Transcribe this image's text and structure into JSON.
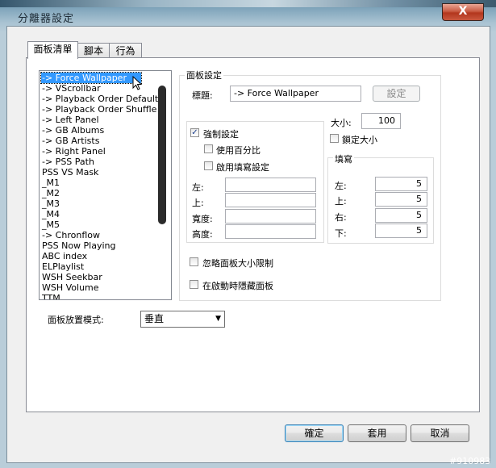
{
  "window": {
    "title": "分離器設定",
    "close_glyph": "X"
  },
  "tabs": [
    {
      "label": "面板清單",
      "active": true
    },
    {
      "label": "腳本",
      "active": false
    },
    {
      "label": "行為",
      "active": false
    }
  ],
  "panel_list": {
    "selected_index": 0,
    "items": [
      "-> Force Wallpaper",
      "-> VScrollbar",
      "-> Playback Order Default",
      "-> Playback Order Shuffle",
      "-> Left Panel",
      "-> GB Albums",
      "-> GB Artists",
      "-> Right Panel",
      "-> PSS Path",
      "PSS VS Mask",
      "_M1",
      "_M2",
      "_M3",
      "_M4",
      "_M5",
      "-> Chronflow",
      "PSS Now Playing",
      "ABC index",
      "ELPlaylist",
      "WSH Seekbar",
      "WSH Volume",
      "TTM"
    ]
  },
  "panel_settings": {
    "group_label": "面板設定",
    "title_label": "標題:",
    "title_value": "-> Force Wallpaper",
    "set_button": "設定",
    "force_settings": {
      "label": "強制設定",
      "checked": true
    },
    "use_percent": {
      "label": "使用百分比",
      "checked": false
    },
    "enable_fill": {
      "label": "啟用填寫設定",
      "checked": false
    },
    "pos_fields": [
      {
        "label": "左:",
        "value": ""
      },
      {
        "label": "上:",
        "value": ""
      },
      {
        "label": "寬度:",
        "value": ""
      },
      {
        "label": "高度:",
        "value": ""
      }
    ],
    "size_label": "大小:",
    "size_value": "100",
    "lock_size": {
      "label": "鎖定大小",
      "checked": false
    },
    "fill_group_label": "填寫",
    "fill_fields": [
      {
        "label": "左:",
        "value": "5"
      },
      {
        "label": "上:",
        "value": "5"
      },
      {
        "label": "右:",
        "value": "5"
      },
      {
        "label": "下:",
        "value": "5"
      }
    ],
    "ignore_limits": {
      "label": "忽略面板大小限制",
      "checked": false
    },
    "hide_on_start": {
      "label": "在啟動時隱藏面板",
      "checked": false
    }
  },
  "placement": {
    "label": "面板放置模式:",
    "value": "垂直"
  },
  "footer": {
    "ok": "確定",
    "apply": "套用",
    "cancel": "取消"
  },
  "watermark": "#910983"
}
